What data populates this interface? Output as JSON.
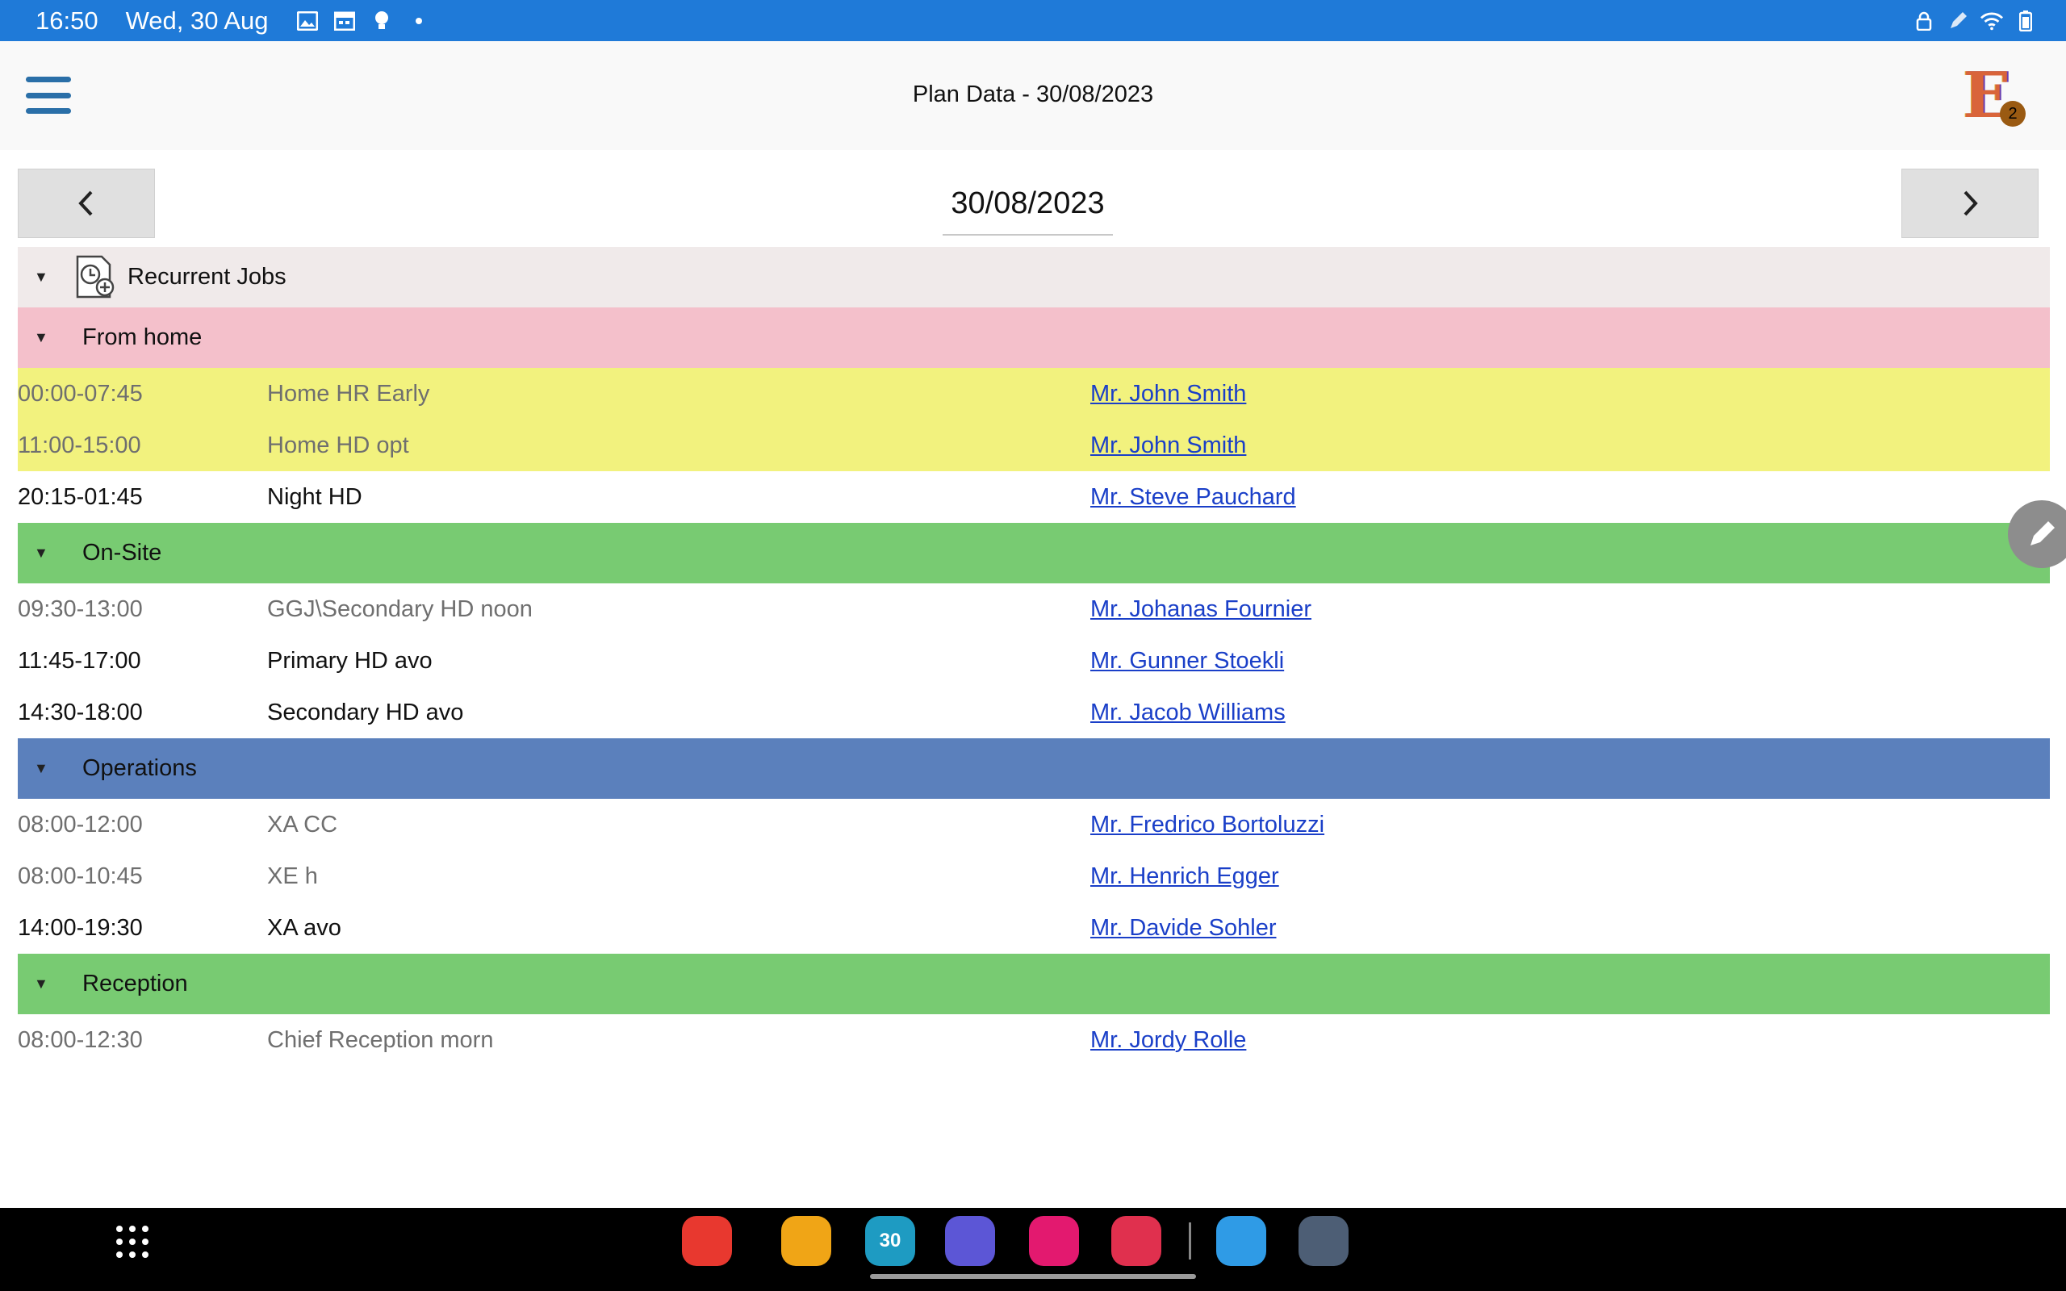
{
  "status_bar": {
    "time": "16:50",
    "date": "Wed, 30 Aug",
    "left_icons": [
      "gallery-icon",
      "calendar-icon",
      "bulb-icon",
      "dot-icon"
    ],
    "right_icons": [
      "lock-icon",
      "pen-icon",
      "wifi-icon",
      "battery-icon"
    ]
  },
  "header": {
    "title": "Plan Data - 30/08/2023",
    "menu_icon": "hamburger-menu-icon",
    "logo_letter": "E",
    "logo_badge": "2"
  },
  "date_nav": {
    "date": "30/08/2023",
    "prev_icon": "chevron-left-icon",
    "next_icon": "chevron-right-icon"
  },
  "root_group": {
    "label": "Recurrent Jobs",
    "icon": "clock-document-icon",
    "color": "#f0eaea"
  },
  "groups": [
    {
      "label": "From home",
      "color": "#f4c0cb",
      "jobs": [
        {
          "time": "00:00-07:45",
          "name": "Home HR Early",
          "person": "Mr. John Smith ",
          "muted": true,
          "bg": "#f2f27e"
        },
        {
          "time": "11:00-15:00",
          "name": "Home HD opt",
          "person": "Mr. John Smith ",
          "muted": true,
          "bg": "#f2f27e"
        },
        {
          "time": "20:15-01:45",
          "name": "Night HD",
          "person": "Mr. Steve Pauchard ",
          "muted": false,
          "bg": "#ffffff"
        }
      ]
    },
    {
      "label": "On-Site",
      "color": "#78cb72",
      "jobs": [
        {
          "time": "09:30-13:00",
          "name": "GGJ\\Secondary HD noon",
          "person": "Mr. Johanas Fournier ",
          "muted": true,
          "bg": "#ffffff"
        },
        {
          "time": "11:45-17:00",
          "name": "Primary HD avo",
          "person": "Mr. Gunner Stoekli ",
          "muted": false,
          "bg": "#ffffff"
        },
        {
          "time": "14:30-18:00",
          "name": "Secondary HD avo",
          "person": "Mr. Jacob Williams ",
          "muted": false,
          "bg": "#ffffff"
        }
      ]
    },
    {
      "label": "Operations",
      "color": "#5b80bc",
      "jobs": [
        {
          "time": "08:00-12:00",
          "name": "XA CC",
          "person": "Mr. Fredrico Bortoluzzi ",
          "muted": true,
          "bg": "#ffffff"
        },
        {
          "time": "08:00-10:45",
          "name": "XE h",
          "person": "Mr. Henrich Egger ",
          "muted": true,
          "bg": "#ffffff"
        },
        {
          "time": "14:00-19:30",
          "name": "XA avo",
          "person": "Mr. Davide Sohler ",
          "muted": false,
          "bg": "#ffffff"
        }
      ]
    },
    {
      "label": "Reception",
      "color": "#78cb72",
      "jobs": [
        {
          "time": "08:00-12:30",
          "name": "Chief Reception morn",
          "person": "Mr. Jordy Rolle ",
          "muted": true,
          "bg": "#ffffff"
        }
      ]
    }
  ],
  "fab": {
    "icon": "pencil-edit-icon"
  },
  "taskbar": {
    "apps": [
      {
        "name": "notes-app-icon",
        "color": "#e8382f",
        "glyph": ""
      },
      {
        "name": "my-files-app-icon",
        "color": "#f0a516",
        "glyph": ""
      },
      {
        "name": "calendar-app-icon",
        "color": "#1e9bc2",
        "glyph": "30"
      },
      {
        "name": "internet-app-icon",
        "color": "#5c56d6",
        "glyph": ""
      },
      {
        "name": "gallery-app-icon",
        "color": "#e3196f",
        "glyph": ""
      },
      {
        "name": "camera-app-icon",
        "color": "#e0304e",
        "glyph": ""
      },
      {
        "name": "bixby-app-icon",
        "color": "#2f9be6",
        "glyph": ""
      },
      {
        "name": "settings-app-icon",
        "color": "#4d5e75",
        "glyph": ""
      }
    ]
  }
}
